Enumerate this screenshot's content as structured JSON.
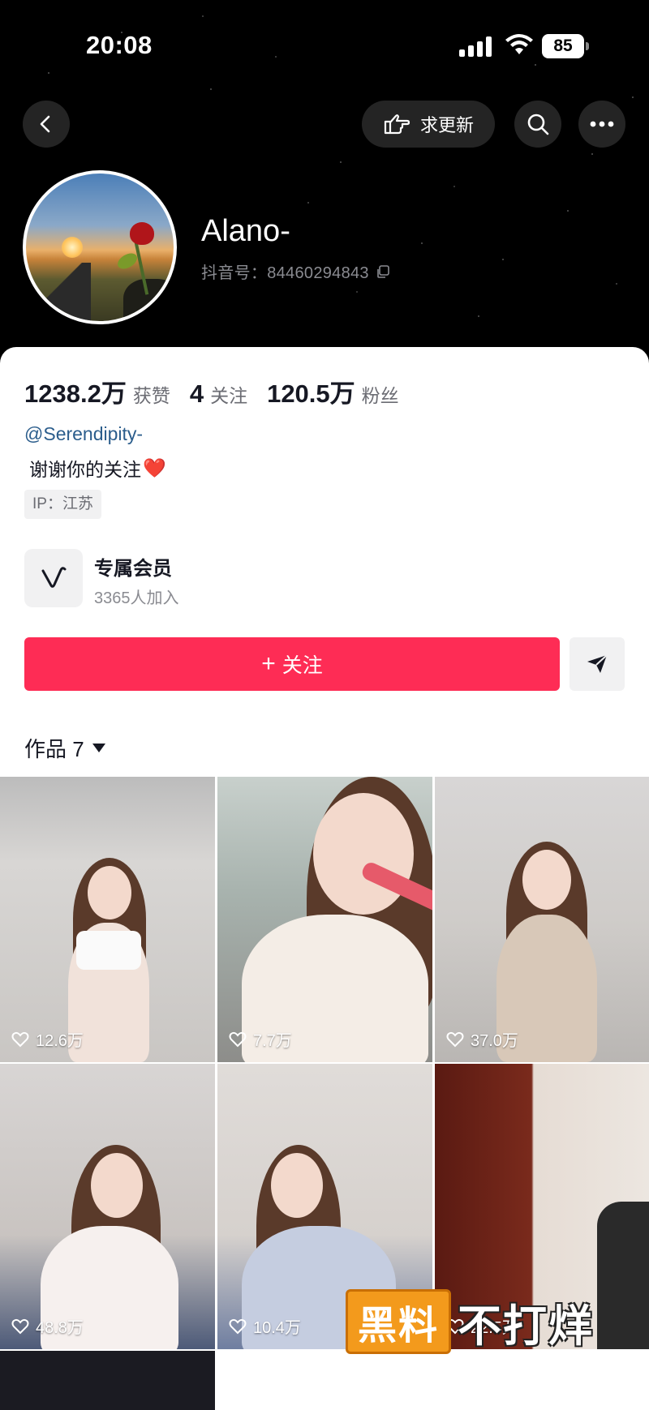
{
  "status_bar": {
    "time": "20:08",
    "battery": "85"
  },
  "nav": {
    "back_icon": "chevron-left-icon",
    "request_update_label": "求更新",
    "search_icon": "search-icon",
    "more_icon": "more-icon"
  },
  "profile": {
    "name": "Alano-",
    "douyin_id": "抖音号：84460294843",
    "avatar_icon": "avatar-sunset-rose"
  },
  "stats": [
    {
      "value": "1238.2万",
      "label": "获赞"
    },
    {
      "value": "4",
      "label": "关注"
    },
    {
      "value": "120.5万",
      "label": "粉丝"
    }
  ],
  "bio": {
    "mention": "@Serendipity-",
    "text": "谢谢你的关注",
    "emoji": "❤️",
    "ip": "IP：江苏"
  },
  "membership": {
    "title": "专属会员",
    "count": "3365人加入"
  },
  "actions": {
    "follow_label": "关注",
    "follow_prefix": "+",
    "share_icon": "send-icon"
  },
  "works": {
    "tab_label": "作品 7",
    "items": [
      {
        "likes": "12.6万"
      },
      {
        "likes": "7.7万"
      },
      {
        "likes": "37.0万"
      },
      {
        "likes": "48.8万"
      },
      {
        "likes": "10.4万"
      },
      {
        "likes": "22.5万"
      }
    ]
  },
  "watermark": {
    "box_text": "黑料",
    "text": "不打烊"
  },
  "colors": {
    "follow": "#fe2c55",
    "mention": "#2b5d8c",
    "watermark": "#f39a1c"
  }
}
